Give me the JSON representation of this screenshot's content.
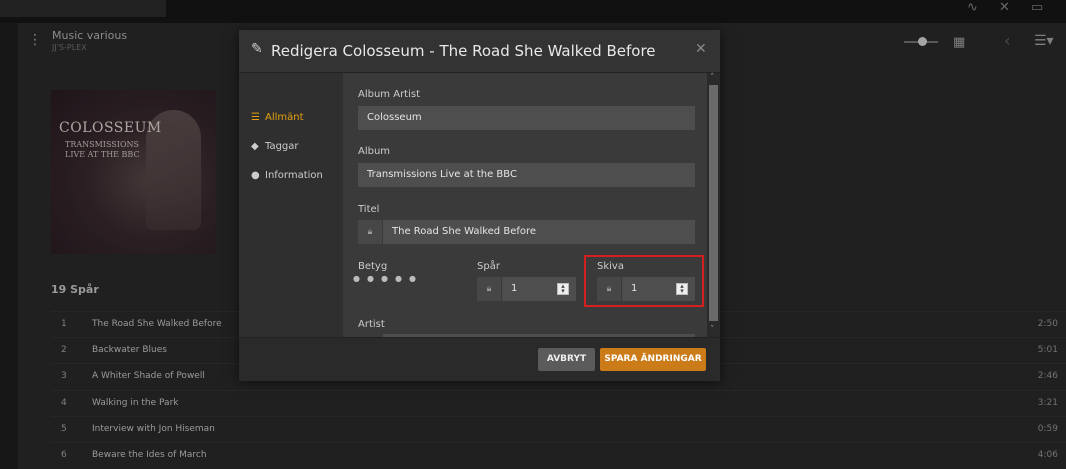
{
  "library": {
    "title": "Music various",
    "server": "JJ'S-PLEX"
  },
  "album": {
    "cover_line1": "COLOSSEUM",
    "cover_line2": "TRANSMISSIONS",
    "cover_line3": "LIVE AT THE BBC"
  },
  "tracks": {
    "heading": "19 Spår",
    "items": [
      {
        "num": "1",
        "title": "The Road She Walked Before",
        "duration": "2:50"
      },
      {
        "num": "2",
        "title": "Backwater Blues",
        "duration": "5:01"
      },
      {
        "num": "3",
        "title": "A Whiter Shade of Powell",
        "duration": "2:46"
      },
      {
        "num": "4",
        "title": "Walking in the Park",
        "duration": "3:21"
      },
      {
        "num": "5",
        "title": "Interview with Jon Hiseman",
        "duration": "0:59"
      },
      {
        "num": "6",
        "title": "Beware the Ides of March",
        "duration": "4:06"
      }
    ]
  },
  "modal": {
    "title": "Redigera Colosseum - The Road She Walked Before",
    "sidebar": [
      {
        "label": "Allmänt",
        "icon": "list-icon",
        "active": true
      },
      {
        "label": "Taggar",
        "icon": "tag-icon",
        "active": false
      },
      {
        "label": "Information",
        "icon": "info-icon",
        "active": false
      }
    ],
    "fields": {
      "album_artist_label": "Album Artist",
      "album_artist_value": "Colosseum",
      "album_label": "Album",
      "album_value": "Transmissions Live at the BBC",
      "title_label": "Titel",
      "title_value": "The Road She Walked Before",
      "rating_label": "Betyg",
      "rating_value": 0,
      "track_label": "Spår",
      "track_value": "1",
      "disc_label": "Skiva",
      "disc_value": "1",
      "artist_label": "Artist"
    },
    "buttons": {
      "cancel": "AVBRYT",
      "save": "SPARA ÄNDRINGAR"
    }
  },
  "colors": {
    "accent": "#e5a00d",
    "save_button": "#cc7b19",
    "highlight": "#d41f1f"
  }
}
